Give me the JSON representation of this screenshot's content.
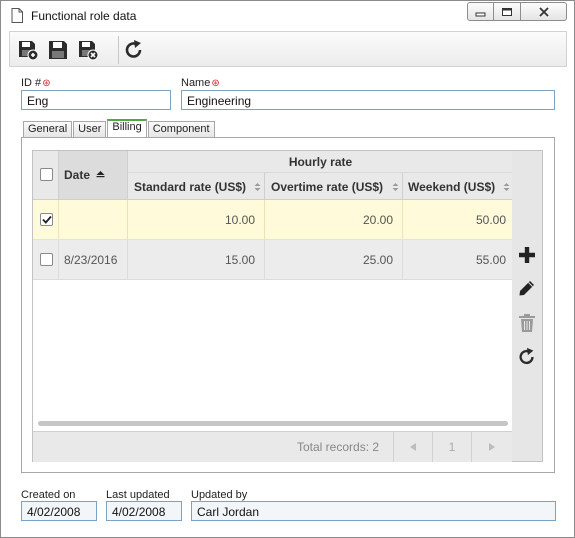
{
  "window": {
    "title": "Functional role data"
  },
  "fields": {
    "id_label": "ID #",
    "id_value": "Eng",
    "name_label": "Name",
    "name_value": "Engineering",
    "required_mark": "⊛"
  },
  "tabs": [
    {
      "label": "General",
      "active": false
    },
    {
      "label": "User",
      "active": false
    },
    {
      "label": "Billing",
      "active": true
    },
    {
      "label": "Component",
      "active": false
    }
  ],
  "grid": {
    "group_header": "Hourly rate",
    "columns": {
      "date": "Date",
      "standard": "Standard rate (US$)",
      "overtime": "Overtime rate (US$)",
      "weekend": "Weekend (US$)"
    },
    "rows": [
      {
        "checked": true,
        "date": "",
        "standard": "10.00",
        "overtime": "20.00",
        "weekend": "50.00"
      },
      {
        "checked": false,
        "date": "8/23/2016",
        "standard": "15.00",
        "overtime": "25.00",
        "weekend": "55.00"
      }
    ],
    "total_records": "Total records: 2",
    "page_number": "1"
  },
  "footer": {
    "created_label": "Created on",
    "created_value": "4/02/2008",
    "updated_label": "Last updated",
    "updated_value": "4/02/2008",
    "updated_by_label": "Updated by",
    "updated_by_value": "Carl Jordan"
  },
  "colors": {
    "selected_row": "#fffad9",
    "required": "#d2262a",
    "active_tab_accent": "#52a744",
    "field_border": "#7aa1c6"
  }
}
